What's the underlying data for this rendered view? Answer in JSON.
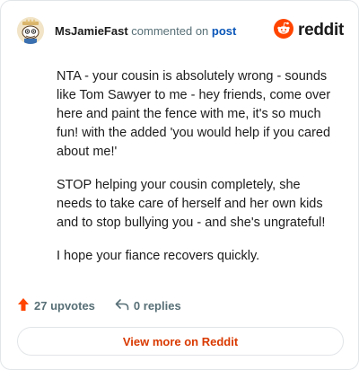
{
  "header": {
    "username": "MsJamieFast",
    "action_text": "commented on",
    "post_link": "post",
    "brand_name": "reddit",
    "avatar_icon": "snoo-avatar-icon",
    "brand_icon": "reddit-logo-icon"
  },
  "comment": {
    "paragraphs": [
      "NTA - your cousin is absolutely wrong - sounds like Tom Sawyer to me - hey friends, come over here and paint the fence with me, it's so much fun! with the added 'you would help if you cared about me!'",
      "STOP helping your cousin completely, she needs to take care of herself and her own kids and to stop bullying you - and she's ungrateful!",
      "I hope your fiance recovers quickly."
    ]
  },
  "footer": {
    "upvotes_label": "27 upvotes",
    "replies_label": "0 replies",
    "upvote_icon": "upvote-arrow-icon",
    "reply_icon": "reply-arrow-icon"
  },
  "cta": {
    "view_more_label": "View more on Reddit"
  },
  "colors": {
    "brand": "#ff4500",
    "link": "#0a56b8",
    "cta_text": "#d93900",
    "muted": "#576f76",
    "border": "#e2e5e8"
  }
}
